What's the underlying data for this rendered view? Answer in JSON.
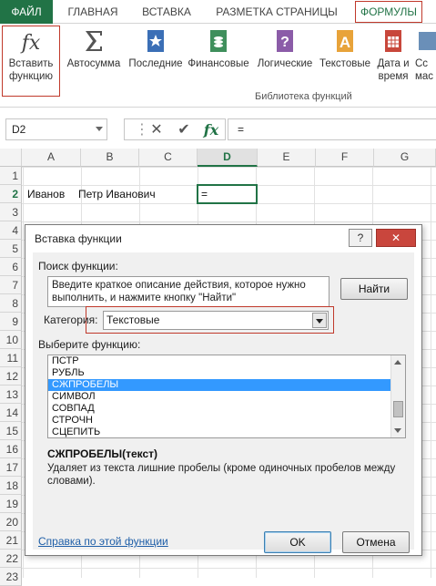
{
  "ribbon_tabs": {
    "file": "ФАЙЛ",
    "home": "ГЛАВНАЯ",
    "insert": "ВСТАВКА",
    "page_layout": "РАЗМЕТКА СТРАНИЦЫ",
    "formulas": "ФОРМУЛЫ"
  },
  "ribbon": {
    "insert_function_line1": "Вставить",
    "insert_function_line2": "функцию",
    "autosum": "Автосумма",
    "recent": "Последние",
    "financial": "Финансовые",
    "logical": "Логические",
    "text": "Текстовые",
    "datetime_line1": "Дата и",
    "datetime_line2": "время",
    "more_line1": "Сс",
    "more_line2": "мас",
    "group_label": "Библиотека функций"
  },
  "formula_bar": {
    "name_box": "D2",
    "fx_symbol": "fx",
    "content": "="
  },
  "grid": {
    "columns": [
      "A",
      "B",
      "C",
      "D",
      "E",
      "F",
      "G"
    ],
    "rows": [
      "1",
      "2",
      "3",
      "4",
      "5",
      "6",
      "7",
      "8",
      "9",
      "10",
      "11",
      "12",
      "13",
      "14",
      "15",
      "16",
      "17",
      "18",
      "19",
      "20",
      "21",
      "22",
      "23"
    ],
    "a2": "Иванов",
    "b2": "Петр Иванович",
    "d2": "="
  },
  "dialog": {
    "title": "Вставка функции",
    "help_btn": "?",
    "close_btn": "✕",
    "search_label": "Поиск функции:",
    "search_text": "Введите краткое описание действия, которое нужно выполнить, и нажмите кнопку \"Найти\"",
    "find_button": "Найти",
    "category_label": "Категория:",
    "category_value": "Текстовые",
    "select_label": "Выберите функцию:",
    "functions": [
      "ПСТР",
      "РУБЛЬ",
      "СЖПРОБЕЛЫ",
      "СИМВОЛ",
      "СОВПАД",
      "СТРОЧН",
      "СЦЕПИТЬ"
    ],
    "selected_function": "СЖПРОБЕЛЫ",
    "signature": "СЖПРОБЕЛЫ(текст)",
    "description": "Удаляет из текста лишние пробелы (кроме одиночных пробелов между словами).",
    "help_link": "Справка по этой функции",
    "ok_button": "OK",
    "cancel_button": "Отмена"
  },
  "colors": {
    "excel_green": "#217346",
    "highlight_red": "#c0392b",
    "selection_blue": "#3399ff"
  }
}
